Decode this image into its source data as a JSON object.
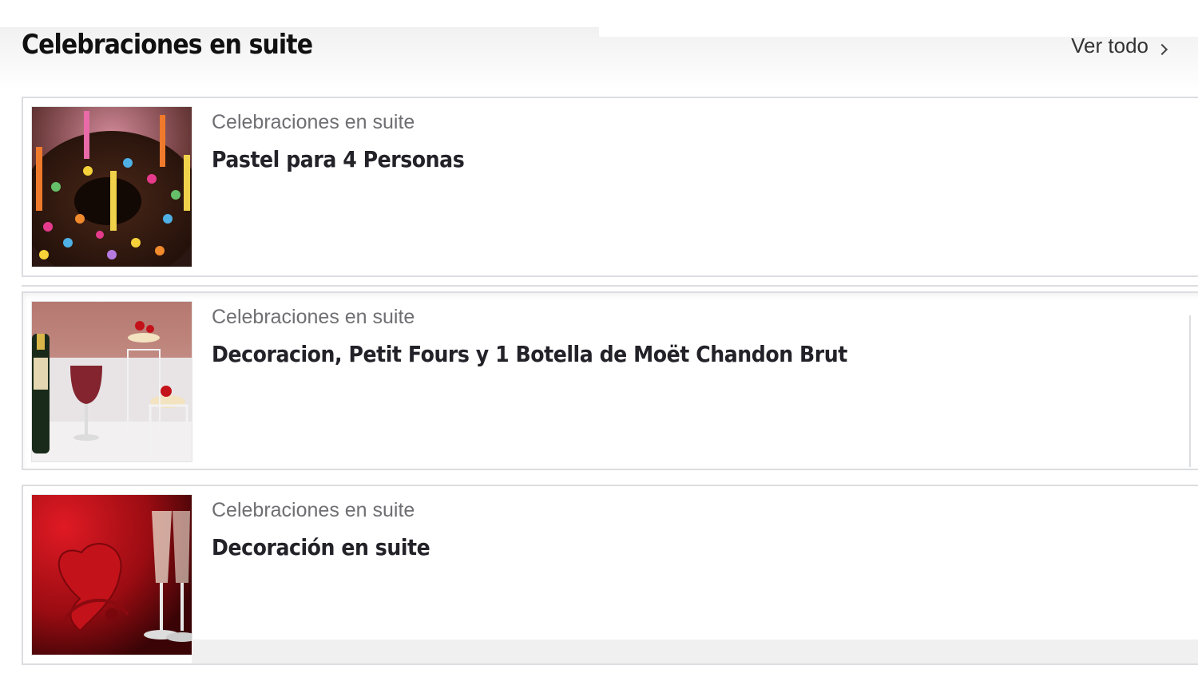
{
  "section": {
    "title": "Celebraciones en suite",
    "see_all_label": "Ver todo"
  },
  "items": [
    {
      "category": "Celebraciones en suite",
      "title": "Pastel para 4 Personas",
      "image": "chocolate-cake-with-candles"
    },
    {
      "category": "Celebraciones en suite",
      "title": "Decoracion, Petit Fours y 1 Botella de Moët Chandon Brut",
      "image": "champagne-wine-and-petit-fours"
    },
    {
      "category": "Celebraciones en suite",
      "title": "Decoración en suite",
      "image": "heart-box-and-champagne-flutes"
    }
  ],
  "colors": {
    "title_text": "#111111",
    "category_text": "#6f6f73",
    "card_border": "#dcdde0",
    "decor_red": "#c4121a"
  }
}
